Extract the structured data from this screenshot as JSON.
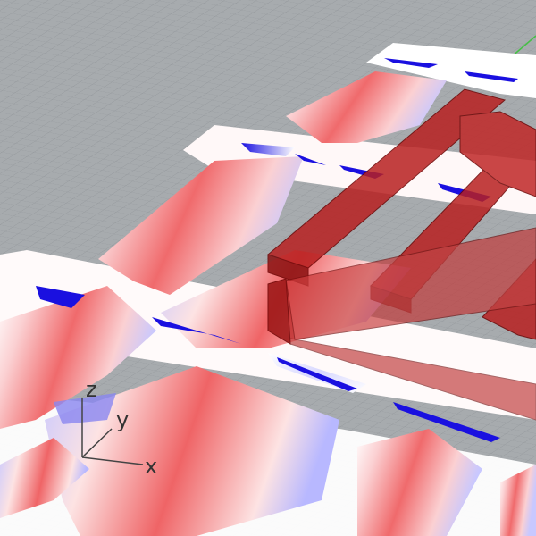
{
  "viewport": {
    "type": "3d-perspective-viewport",
    "background": "#a7abae",
    "grid": true
  },
  "axis_triad": {
    "labels": {
      "z": "z",
      "y": "y",
      "x": "x"
    }
  },
  "colors": {
    "stress_high": "#e8303a",
    "stress_low": "#1a10e0",
    "neutral": "#fff5f5",
    "grid_line": "#8e9296",
    "grid_axis_green": "#46c046",
    "solid_red": "#b01818"
  },
  "icons": {
    "axis_triad": "xyz-axis-icon"
  }
}
